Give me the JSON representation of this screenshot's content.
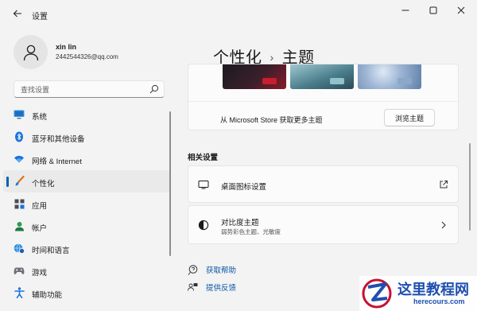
{
  "app": {
    "title": "设置",
    "back_icon": "arrow-left-icon"
  },
  "window_controls": [
    "minimize-icon",
    "maximize-icon",
    "close-icon"
  ],
  "user": {
    "name": "xin lin",
    "email": "2442544326@qq.com"
  },
  "search": {
    "placeholder": "查找设置",
    "icon": "search-icon"
  },
  "sidebar": {
    "items": [
      {
        "label": "系统",
        "icon": "monitor-icon",
        "active": false
      },
      {
        "label": "蓝牙和其他设备",
        "icon": "bluetooth-icon",
        "active": false
      },
      {
        "label": "网络 & Internet",
        "icon": "wifi-icon",
        "active": false
      },
      {
        "label": "个性化",
        "icon": "paintbrush-icon",
        "active": true
      },
      {
        "label": "应用",
        "icon": "apps-icon",
        "active": false
      },
      {
        "label": "帐户",
        "icon": "person-icon",
        "active": false
      },
      {
        "label": "时间和语言",
        "icon": "globe-clock-icon",
        "active": false
      },
      {
        "label": "游戏",
        "icon": "gamepad-icon",
        "active": false
      },
      {
        "label": "辅助功能",
        "icon": "accessibility-icon",
        "active": false
      }
    ]
  },
  "breadcrumb": {
    "parent": "个性化",
    "separator": "›",
    "current": "主题"
  },
  "themes": {
    "store_text": "从 Microsoft Store 获取更多主题",
    "browse_button": "浏览主题"
  },
  "related": {
    "title": "相关设置",
    "desktop_icons": {
      "label": "桌面图标设置",
      "action_icon": "external-link-icon"
    },
    "contrast": {
      "label": "对比度主题",
      "subtitle": "弱势彩色主题、光敏度",
      "action_icon": "chevron-right-icon"
    }
  },
  "links": {
    "help": "获取帮助",
    "feedback": "提供反馈"
  },
  "watermark": {
    "title": "这里教程网",
    "url": "herecours.com"
  },
  "colors": {
    "accent": "#005fb8",
    "link": "#0a57a8",
    "background": "#f3f3f3",
    "card": "#fbfbfb",
    "watermark_blue": "#1f4fae",
    "watermark_red": "#c8102e"
  }
}
